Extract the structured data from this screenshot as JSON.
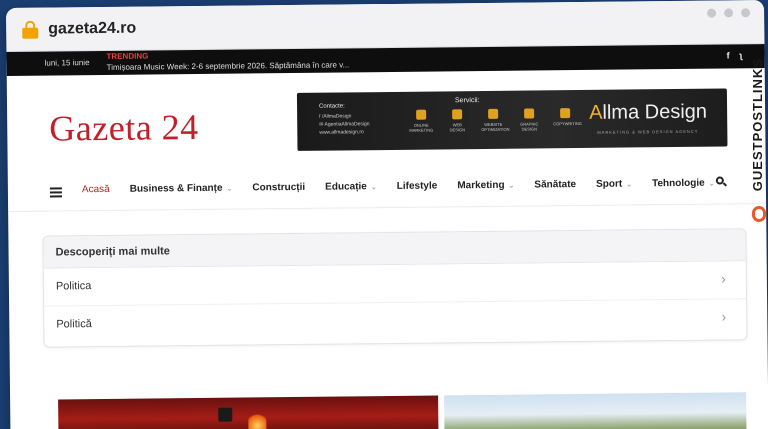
{
  "browser": {
    "url": "gazeta24.ro"
  },
  "topbar": {
    "date": "luni, 15 iunie",
    "trending_label": "TRENDING",
    "trending_text": "Timișoara Music Week: 2-6 septembrie 2026. Săptămâna în care v...",
    "social": [
      "f",
      "rss"
    ]
  },
  "header": {
    "logo": "Gazeta 24",
    "banner": {
      "contact_title": "Contacte:",
      "contact_lines": [
        "f /AllmaDesign",
        "✉ AgentiaAllmaDesign",
        "www.allmadesign.ro"
      ],
      "services_title": "Servicii:",
      "services": [
        "ONLINE MARKETING",
        "WEB DESIGN",
        "WEBSITE OPTIMIZATION",
        "GRAPHIC DESIGN",
        "COPYWRITING"
      ],
      "brand_a": "A",
      "brand_rest": "llma Design",
      "brand_sub": "MARKETING & WEB DESIGN AGENCY"
    }
  },
  "nav": {
    "items": [
      {
        "label": "Acasă",
        "active": true,
        "dropdown": false
      },
      {
        "label": "Business & Finanțe",
        "active": false,
        "dropdown": true
      },
      {
        "label": "Construcții",
        "active": false,
        "dropdown": false
      },
      {
        "label": "Educație",
        "active": false,
        "dropdown": true
      },
      {
        "label": "Lifestyle",
        "active": false,
        "dropdown": false
      },
      {
        "label": "Marketing",
        "active": false,
        "dropdown": true
      },
      {
        "label": "Sănătate",
        "active": false,
        "dropdown": false
      },
      {
        "label": "Sport",
        "active": false,
        "dropdown": true
      },
      {
        "label": "Tehnologie",
        "active": false,
        "dropdown": true
      }
    ]
  },
  "discover": {
    "title": "Descoperiți mai multe",
    "items": [
      "Politica",
      "Politică"
    ]
  },
  "side_brand": "GUESTPOSTLINKS",
  "colors": {
    "accent": "#c0202a",
    "topbar": "#0e0e0e",
    "background": "#1b3f73"
  }
}
